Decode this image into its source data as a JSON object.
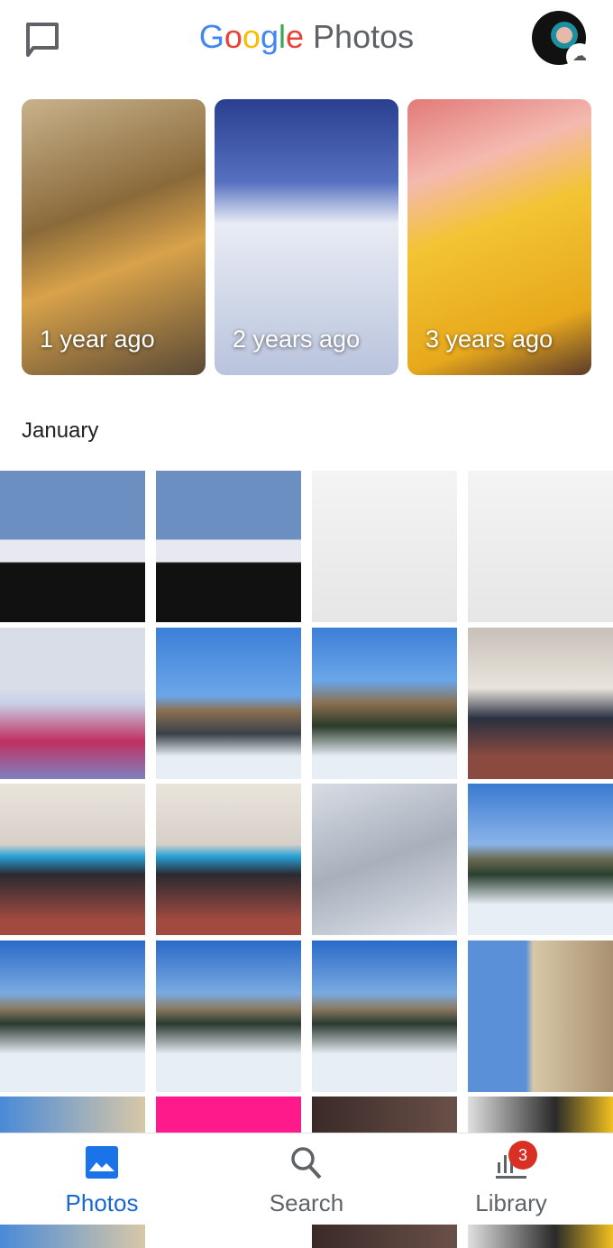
{
  "header": {
    "logo": {
      "google": "Google",
      "product": "Photos"
    },
    "logo_colors": [
      "#4285f4",
      "#ea4335",
      "#fbbc05",
      "#4285f4",
      "#34a853",
      "#ea4335"
    ],
    "icons": {
      "chat": "chat-bubble-icon",
      "avatar": "avatar",
      "backup": "backup-off-icon"
    }
  },
  "memories": [
    {
      "label": "1 year ago"
    },
    {
      "label": "2 years ago"
    },
    {
      "label": "3 years ago"
    }
  ],
  "section": {
    "month": "January"
  },
  "nav": {
    "items": [
      {
        "label": "Photos",
        "icon": "photos-icon",
        "active": true
      },
      {
        "label": "Search",
        "icon": "search-icon"
      },
      {
        "label": "Library",
        "icon": "library-icon",
        "badge": "3"
      }
    ],
    "active_color": "#1967d2",
    "badge_color": "#d93025"
  }
}
